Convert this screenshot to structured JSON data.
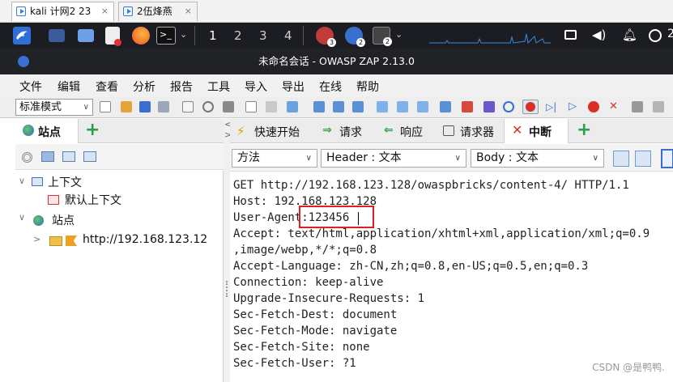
{
  "vm_tabs": [
    {
      "label": "kali 计网2 23",
      "close": "×"
    },
    {
      "label": "2伍烽燕",
      "close": "×"
    }
  ],
  "panel": {
    "workspaces": [
      "1",
      "2",
      "3",
      "4"
    ],
    "badges": [
      "3",
      "2",
      "2"
    ]
  },
  "window": {
    "title": "未命名会话 - OWASP ZAP 2.13.0"
  },
  "menu": [
    "文件",
    "编辑",
    "查看",
    "分析",
    "报告",
    "工具",
    "导入",
    "导出",
    "在线",
    "帮助"
  ],
  "toolbar": {
    "mode": "标准模式"
  },
  "left_tabs": {
    "sites": "站点",
    "add": "+"
  },
  "tree": {
    "contexts": "上下文",
    "default_context": "默认上下文",
    "sites": "站点",
    "host": "http://192.168.123.12"
  },
  "right_tabs": [
    "快速开始",
    "请求",
    "响应",
    "请求器",
    "中断",
    "+"
  ],
  "selectors": {
    "method": "方法",
    "header": "Header : 文本",
    "body": "Body : 文本"
  },
  "request_lines": [
    "GET http://192.168.123.128/owaspbricks/content-4/ HTTP/1.1",
    "Host: 192.168.123.128",
    "User-Agent:123456",
    "Accept: text/html,application/xhtml+xml,application/xml;q=0.9",
    ",image/webp,*/*;q=0.8",
    "Accept-Language: zh-CN,zh;q=0.8,en-US;q=0.5,en;q=0.3",
    "Connection: keep-alive",
    "Upgrade-Insecure-Requests: 1",
    "Sec-Fetch-Dest: document",
    "Sec-Fetch-Mode: navigate",
    "Sec-Fetch-Site: none",
    "Sec-Fetch-User: ?1"
  ],
  "watermark": "CSDN @是鸭鸭.",
  "colors": {
    "panel": "#1b1d22",
    "titlebar": "#202225",
    "highlight": "#e02020",
    "add_green": "#2ea043",
    "break_red": "#d93025"
  }
}
